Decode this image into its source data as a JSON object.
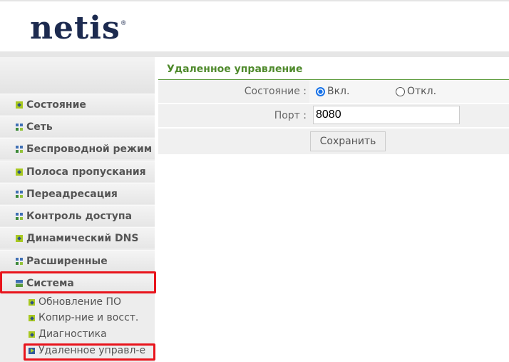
{
  "header": {
    "logo": "netis",
    "logo_mark": "®"
  },
  "sidebar": {
    "items": [
      {
        "label": "Состояние",
        "icon": "plus-icon"
      },
      {
        "label": "Сеть",
        "icon": "grid-icon"
      },
      {
        "label": "Беспроводной режим",
        "icon": "grid-icon"
      },
      {
        "label": "Полоса пропускания",
        "icon": "plus-icon"
      },
      {
        "label": "Переадресация",
        "icon": "grid-icon"
      },
      {
        "label": "Контроль доступа",
        "icon": "grid-icon"
      },
      {
        "label": "Динамический DNS",
        "icon": "plus-icon"
      },
      {
        "label": "Расширенные",
        "icon": "grid-icon"
      },
      {
        "label": "Система",
        "icon": "minus-icon"
      }
    ],
    "subitems": [
      {
        "label": "Обновление ПО"
      },
      {
        "label": "Копир-ние и восст."
      },
      {
        "label": "Диагностика"
      },
      {
        "label": "Удаленное управл-е",
        "active": true
      }
    ]
  },
  "main": {
    "title": "Удаленное управление",
    "status_label": "Состояние :",
    "on_label": "Вкл.",
    "off_label": "Откл.",
    "status_value": "on",
    "port_label": "Порт :",
    "port_value": "8080",
    "save_label": "Сохранить"
  },
  "colors": {
    "highlight": "#e8141c",
    "title": "#4f8a2c"
  }
}
